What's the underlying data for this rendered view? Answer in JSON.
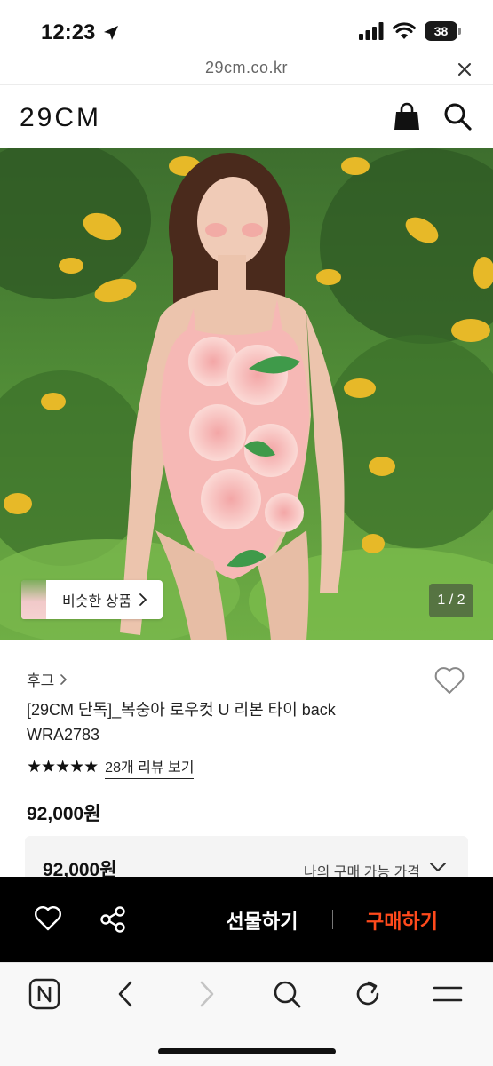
{
  "status_bar": {
    "time": "12:23",
    "battery": "38"
  },
  "browser": {
    "url": "29cm.co.kr"
  },
  "header": {
    "logo": "29CM"
  },
  "gallery": {
    "similar_products_label": "비슷한 상품",
    "pager": "1 / 2"
  },
  "product": {
    "brand": "후그",
    "title": "[29CM 단독]_복숭아 로우컷 U 리본 타이 back WRA2783",
    "stars": "★★★★★",
    "rating": 5,
    "review_link": "28개 리뷰 보기",
    "price": "92,000원"
  },
  "price_box": {
    "value": "92,000원",
    "label": "나의 구매 가능 가격"
  },
  "action_bar": {
    "gift_label": "선물하기",
    "buy_label": "구매하기"
  },
  "colors": {
    "buy_accent": "#ff4a1c",
    "action_bar_bg": "#000000"
  },
  "icons": [
    "navigation-arrow-icon",
    "signal-icon",
    "wifi-icon",
    "battery-icon",
    "close-icon",
    "shopping-bag-icon",
    "search-icon",
    "chevron-right-icon",
    "heart-icon",
    "star-icon",
    "chevron-down-icon",
    "share-icon",
    "naver-icon",
    "back-icon",
    "forward-icon",
    "refresh-icon",
    "menu-icon"
  ]
}
